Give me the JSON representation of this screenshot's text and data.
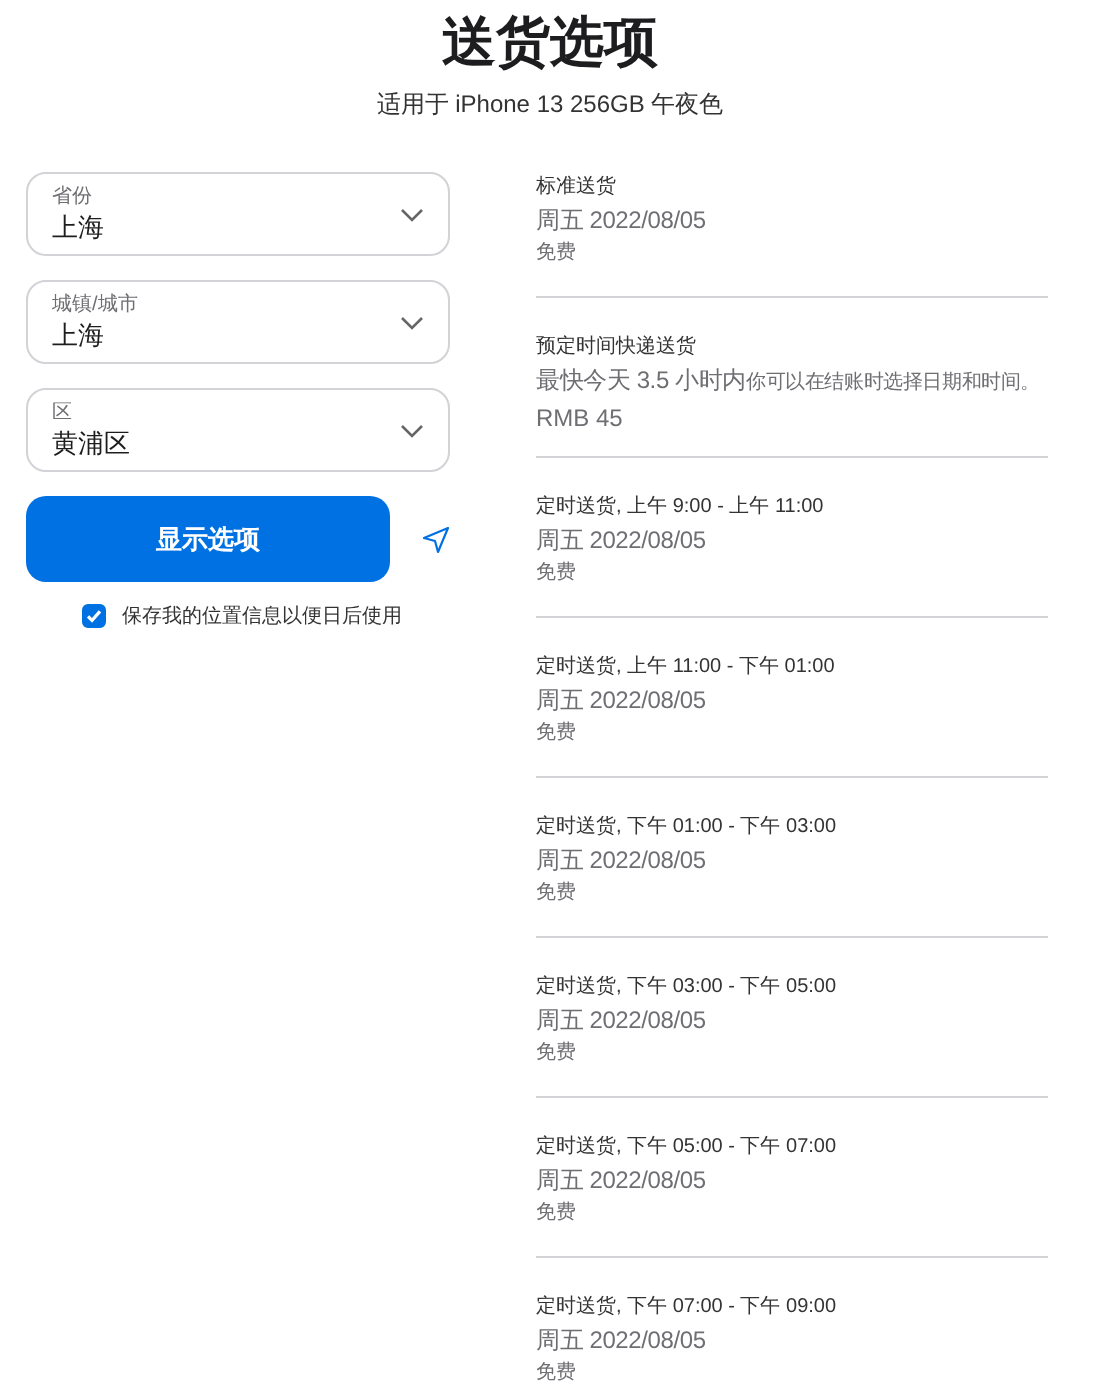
{
  "title": "送货选项",
  "subtitle": "适用于 iPhone 13 256GB 午夜色",
  "fields": [
    {
      "label": "省份",
      "value": "上海"
    },
    {
      "label": "城镇/城市",
      "value": "上海"
    },
    {
      "label": "区",
      "value": "黄浦区"
    }
  ],
  "button": "显示选项",
  "save_location": {
    "label": "保存我的位置信息以便日后使用",
    "checked": true
  },
  "options": [
    {
      "kind": "standard",
      "name": "标准送货",
      "date": "周五 2022/08/05",
      "price": "免费"
    },
    {
      "kind": "express",
      "name": "预定时间快递送货",
      "eta": "最快今天 3.5 小时内",
      "note": "你可以在结账时选择日期和时间。",
      "price": "RMB 45"
    },
    {
      "kind": "standard",
      "name": "定时送货, 上午 9:00 - 上午 11:00",
      "date": "周五 2022/08/05",
      "price": "免费"
    },
    {
      "kind": "standard",
      "name": "定时送货, 上午 11:00 - 下午 01:00",
      "date": "周五 2022/08/05",
      "price": "免费"
    },
    {
      "kind": "standard",
      "name": "定时送货, 下午 01:00 - 下午 03:00",
      "date": "周五 2022/08/05",
      "price": "免费"
    },
    {
      "kind": "standard",
      "name": "定时送货, 下午 03:00 - 下午 05:00",
      "date": "周五 2022/08/05",
      "price": "免费"
    },
    {
      "kind": "standard",
      "name": "定时送货, 下午 05:00 - 下午 07:00",
      "date": "周五 2022/08/05",
      "price": "免费"
    },
    {
      "kind": "standard",
      "name": "定时送货, 下午 07:00 - 下午 09:00",
      "date": "周五 2022/08/05",
      "price": "免费"
    }
  ]
}
